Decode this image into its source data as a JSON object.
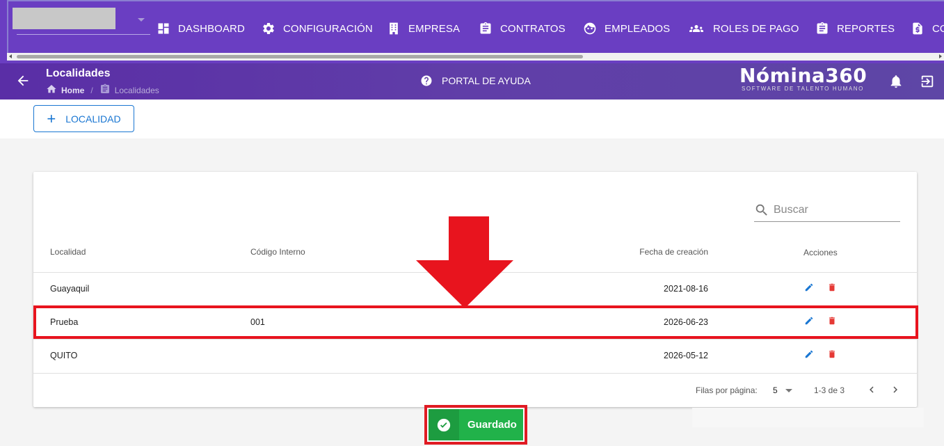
{
  "nav": {
    "items": [
      {
        "label": "DASHBOARD",
        "icon": "dashboard-icon"
      },
      {
        "label": "CONFIGURACIÓN",
        "icon": "gear-icon"
      },
      {
        "label": "EMPRESA",
        "icon": "building-icon"
      },
      {
        "label": "CONTRATOS",
        "icon": "clipboard-icon"
      },
      {
        "label": "EMPLEADOS",
        "icon": "face-icon"
      },
      {
        "label": "ROLES DE PAGO",
        "icon": "group-icon"
      },
      {
        "label": "REPORTES",
        "icon": "clipboard-icon"
      },
      {
        "label": "CO",
        "icon": "dollar-document-icon"
      }
    ]
  },
  "header": {
    "title": "Localidades",
    "breadcrumb": {
      "home": "Home",
      "current": "Localidades"
    },
    "help_label": "PORTAL DE AYUDA",
    "logo_main": "Nómina360",
    "logo_sub": "SOFTWARE DE TALENTO HUMANO"
  },
  "toolbar": {
    "add_label": "LOCALIDAD"
  },
  "search": {
    "placeholder": "Buscar"
  },
  "table": {
    "columns": [
      "Localidad",
      "Código Interno",
      "Fecha de creación",
      "Acciones"
    ],
    "rows": [
      {
        "localidad": "Guayaquil",
        "codigo": "",
        "fecha": "2021-08-16"
      },
      {
        "localidad": "Prueba",
        "codigo": "001",
        "fecha": "2026-06-23"
      },
      {
        "localidad": "QUITO",
        "codigo": "",
        "fecha": "2026-05-12"
      }
    ],
    "footer": {
      "rows_per_page_label": "Filas por página:",
      "rows_per_page": "5",
      "range": "1-3 de 3"
    }
  },
  "toast": {
    "message": "Guardado"
  },
  "colors": {
    "primary": "#6a3ec2",
    "accent": "#1976d2",
    "delete": "#e53935",
    "success": "#21b24a",
    "annotation": "#e8141e"
  }
}
